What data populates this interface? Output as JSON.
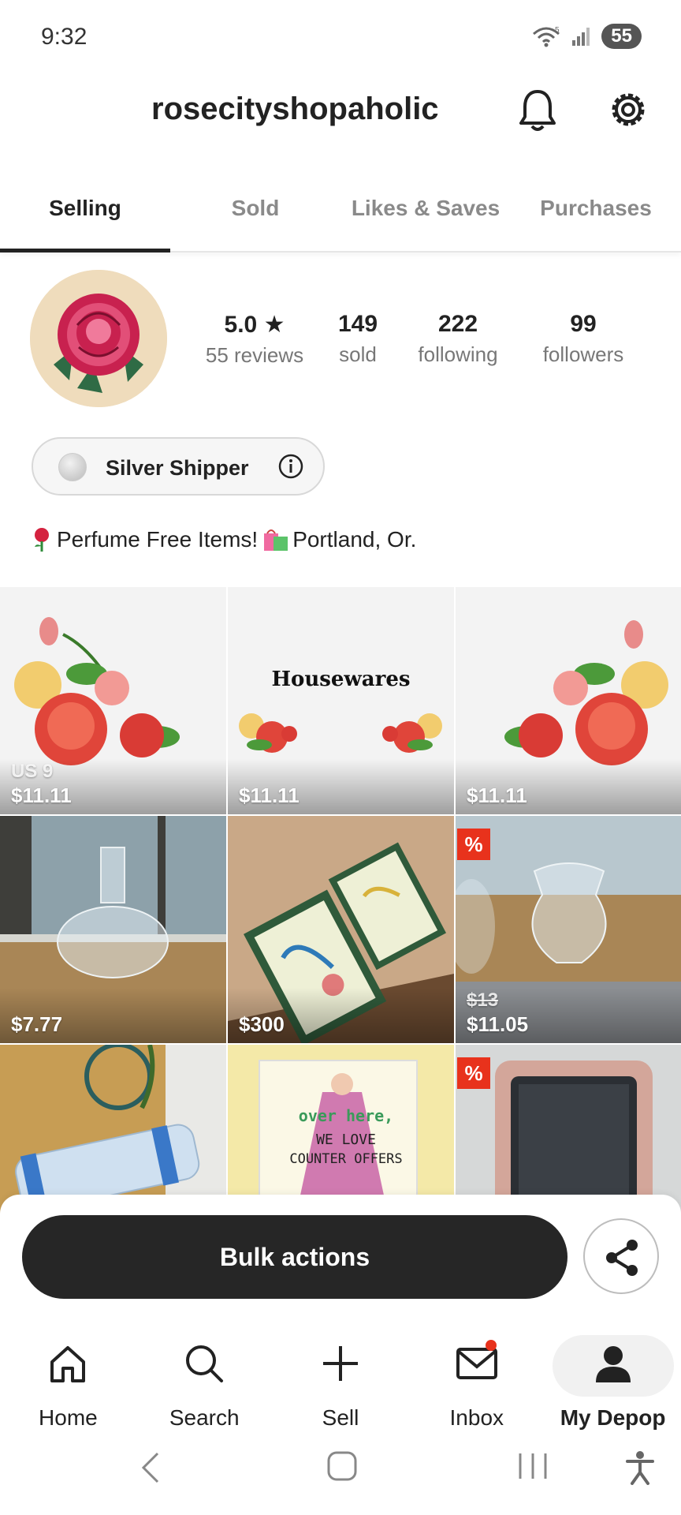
{
  "status_bar": {
    "time": "9:32",
    "battery": "55",
    "wifi_label": "5"
  },
  "header": {
    "username": "rosecityshopaholic"
  },
  "tabs": [
    {
      "label": "Selling",
      "active": true
    },
    {
      "label": "Sold",
      "active": false
    },
    {
      "label": "Likes & Saves",
      "active": false
    },
    {
      "label": "Purchases",
      "active": false
    }
  ],
  "profile": {
    "rating": "5.0 ★",
    "reviews": "55 reviews",
    "sold_count": "149",
    "sold_label": "sold",
    "following_count": "222",
    "following_label": "following",
    "followers_count": "99",
    "followers_label": "followers",
    "badge": "Silver Shipper",
    "bio": "Perfume Free Items! ",
    "bio_location": "Portland, Or."
  },
  "listings": [
    {
      "size": "US 9",
      "price": "$11.11",
      "image": "roses-left"
    },
    {
      "price": "$11.11",
      "image": "housewares",
      "caption": "Housewares"
    },
    {
      "price": "$11.11",
      "image": "roses-right"
    },
    {
      "price": "$7.77",
      "image": "glass-decanter"
    },
    {
      "price": "$300",
      "image": "framed-embroidery"
    },
    {
      "original_price": "$13",
      "price": "$11.05",
      "discount_badge": "%",
      "image": "glass-vase"
    },
    {
      "image": "bike-tube"
    },
    {
      "image": "counter-offers-photo",
      "overlay_text": [
        "over here,",
        "WE LOVE",
        "COUNTER OFFERS"
      ]
    },
    {
      "discount_badge": "%",
      "image": "phone-case"
    }
  ],
  "bottom": {
    "bulk_actions_label": "Bulk actions"
  },
  "nav": [
    {
      "label": "Home",
      "icon": "home-icon"
    },
    {
      "label": "Search",
      "icon": "search-icon"
    },
    {
      "label": "Sell",
      "icon": "plus-icon"
    },
    {
      "label": "Inbox",
      "icon": "mail-icon"
    },
    {
      "label": "My Depop",
      "icon": "person-icon",
      "active": true
    }
  ],
  "colors": {
    "accent_dark": "#262626",
    "discount_red": "#e8321c",
    "rose_pink": "#e0245e"
  }
}
